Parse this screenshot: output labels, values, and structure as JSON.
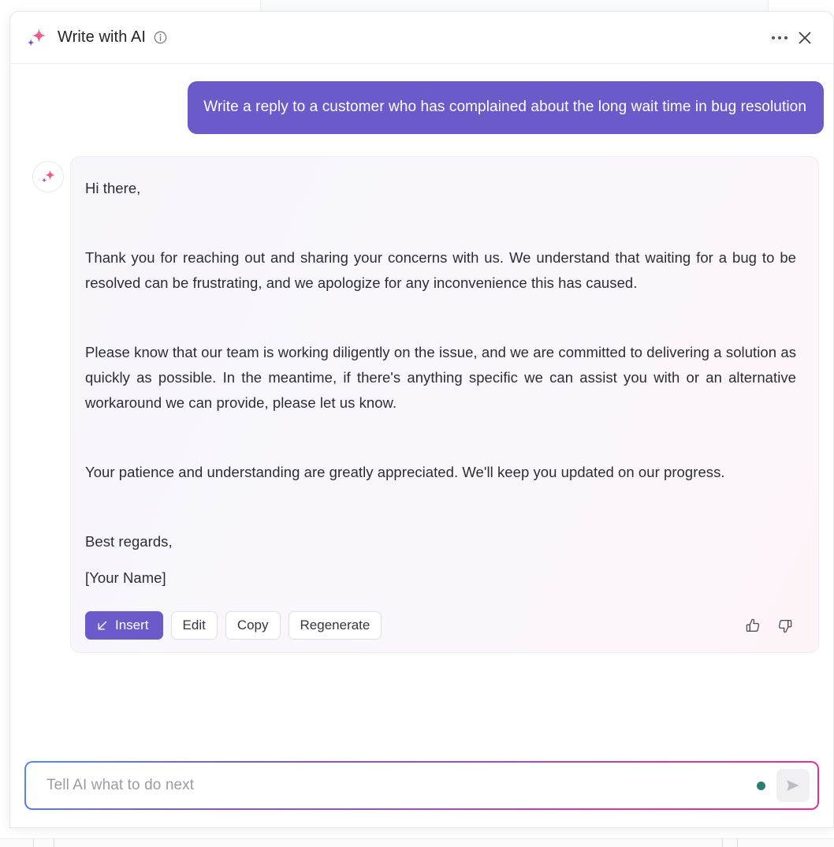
{
  "header": {
    "title": "Write with AI",
    "sparkle_icon": "sparkle-icon",
    "info_icon": "info-icon",
    "more_label": "…",
    "close_label": "✕"
  },
  "conversation": {
    "user_message": "Write a reply to a customer who has complained about the long wait time in bug resolution",
    "ai_response": {
      "greeting": "Hi there,",
      "paragraph_1": "Thank you for reaching out and sharing your concerns with us. We understand that waiting for a bug to be resolved can be frustrating, and we apologize for any inconvenience this has caused.",
      "paragraph_2": "Please know that our team is working diligently on the issue, and we are committed to delivering a solution as quickly as possible. In the meantime, if there's anything specific we can assist you with or an alternative workaround we can provide, please let us know.",
      "paragraph_3": "Your patience and understanding are greatly appreciated. We'll keep you updated on our progress.",
      "sign_off": "Best regards,",
      "signature": "[Your Name]"
    }
  },
  "actions": {
    "insert_label": "Insert",
    "insert_icon": "arrow-down-left-icon",
    "edit_label": "Edit",
    "copy_label": "Copy",
    "regenerate_label": "Regenerate",
    "thumbs_up_icon": "thumbs-up-icon",
    "thumbs_down_icon": "thumbs-down-icon"
  },
  "composer": {
    "placeholder": "Tell AI what to do next",
    "value": "",
    "status_dot_color": "#2e7d6e",
    "send_icon": "send-icon"
  },
  "colors": {
    "accent_purple": "#6b5ac9",
    "card_background": "#f8f6fb",
    "border": "#e7e7ea",
    "gradient_start": "#4f8df5",
    "gradient_end": "#e42e8f"
  }
}
